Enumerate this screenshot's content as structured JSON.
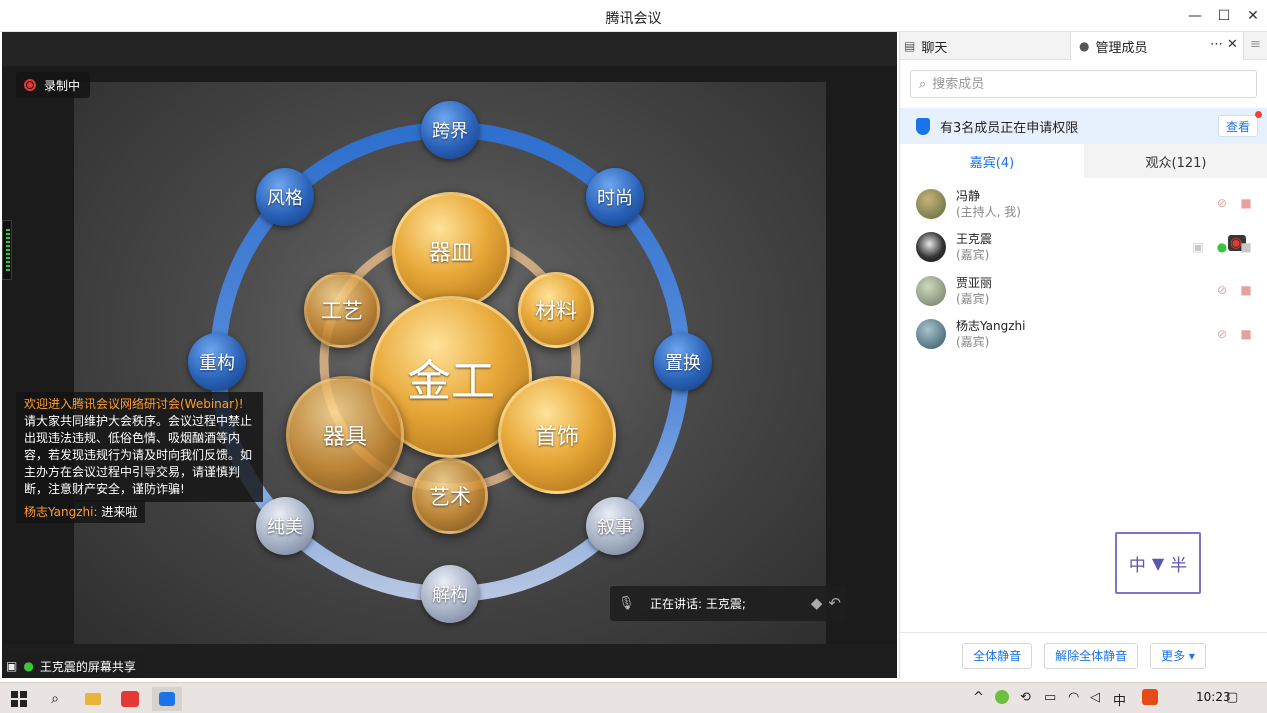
{
  "window": {
    "title": "腾讯会议",
    "controls": [
      "—",
      "☐",
      "✕"
    ]
  },
  "stage": {
    "recording_label": "录制中",
    "notice_title": "欢迎进入腾讯会议网络研讨会(Webinar)!",
    "notice_body": "请大家共同维护大会秩序。会议过程中禁止出现违法违规、低俗色情、吸烟酗酒等内容，若发现违规行为请及时向我们反馈。如主办方在会议过程中引导交易，请谨慎判断，注意财产安全，谨防诈骗!",
    "chat_author": "杨志Yangzhi:",
    "chat_message": " 进来啦",
    "speaking_label": "正在讲话: 王克震;",
    "share_label": "王克震的屏幕共享"
  },
  "slide": {
    "center": "金工",
    "inner": [
      "器皿",
      "材料",
      "首饰",
      "艺术",
      "器具",
      "工艺"
    ],
    "outer": [
      "跨界",
      "时尚",
      "置换",
      "叙事",
      "解构",
      "纯美",
      "重构",
      "风格"
    ]
  },
  "panel": {
    "tab_chat": "聊天",
    "tab_members": "管理成员",
    "tab_more": "⋯",
    "tab_close": "✕",
    "tab_menu": "≡",
    "search_placeholder": "搜索成员",
    "permission_text": "有3名成员正在申请权限",
    "permission_action": "查看",
    "subtab_guests": "嘉宾(4)",
    "subtab_audience": "观众(121)",
    "members": [
      {
        "name": "冯静",
        "role": "(主持人, 我)"
      },
      {
        "name": "王克震",
        "role": "(嘉宾)"
      },
      {
        "name": "贾亚丽",
        "role": "(嘉宾)"
      },
      {
        "name": "杨志Yangzhi",
        "role": "(嘉宾)"
      }
    ],
    "logo_left": "中",
    "logo_right": "半",
    "btn_mute_all": "全体静音",
    "btn_unmute_all": "解除全体静音",
    "btn_more": "更多 ▾"
  },
  "taskbar": {
    "clock": "10:23",
    "ime": "中"
  },
  "colors": {
    "accent": "#1a73e8",
    "record": "#e53935",
    "notice_highlight": "#ff9d2e",
    "mic_on": "#3cc43c"
  }
}
